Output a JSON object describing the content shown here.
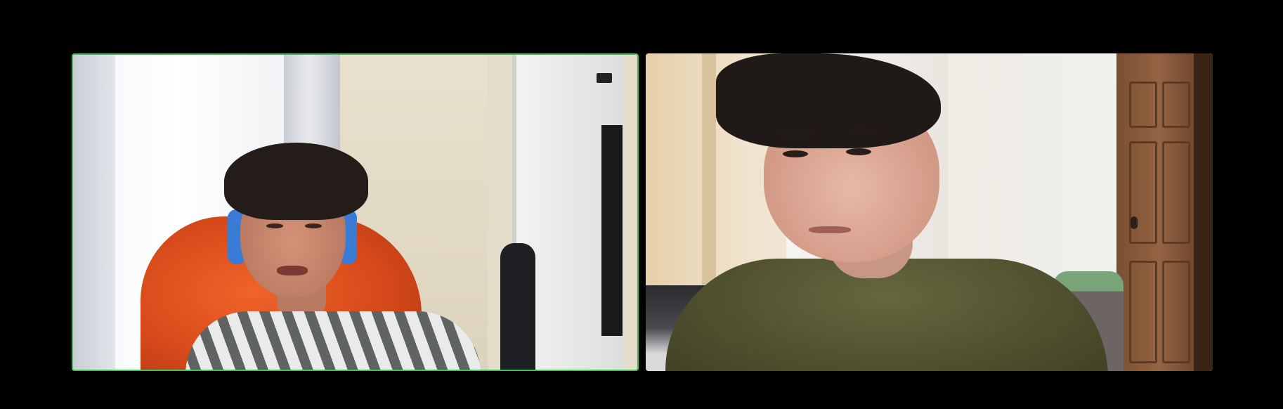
{
  "meeting": {
    "layout": "gallery-view",
    "tiles": [
      {
        "id": "participant-1",
        "active_speaker": true,
        "highlight_color": "#3fbf5a"
      },
      {
        "id": "participant-2",
        "active_speaker": false
      }
    ]
  },
  "colors": {
    "background": "#000000",
    "active_speaker_border": "#3fbf5a"
  }
}
